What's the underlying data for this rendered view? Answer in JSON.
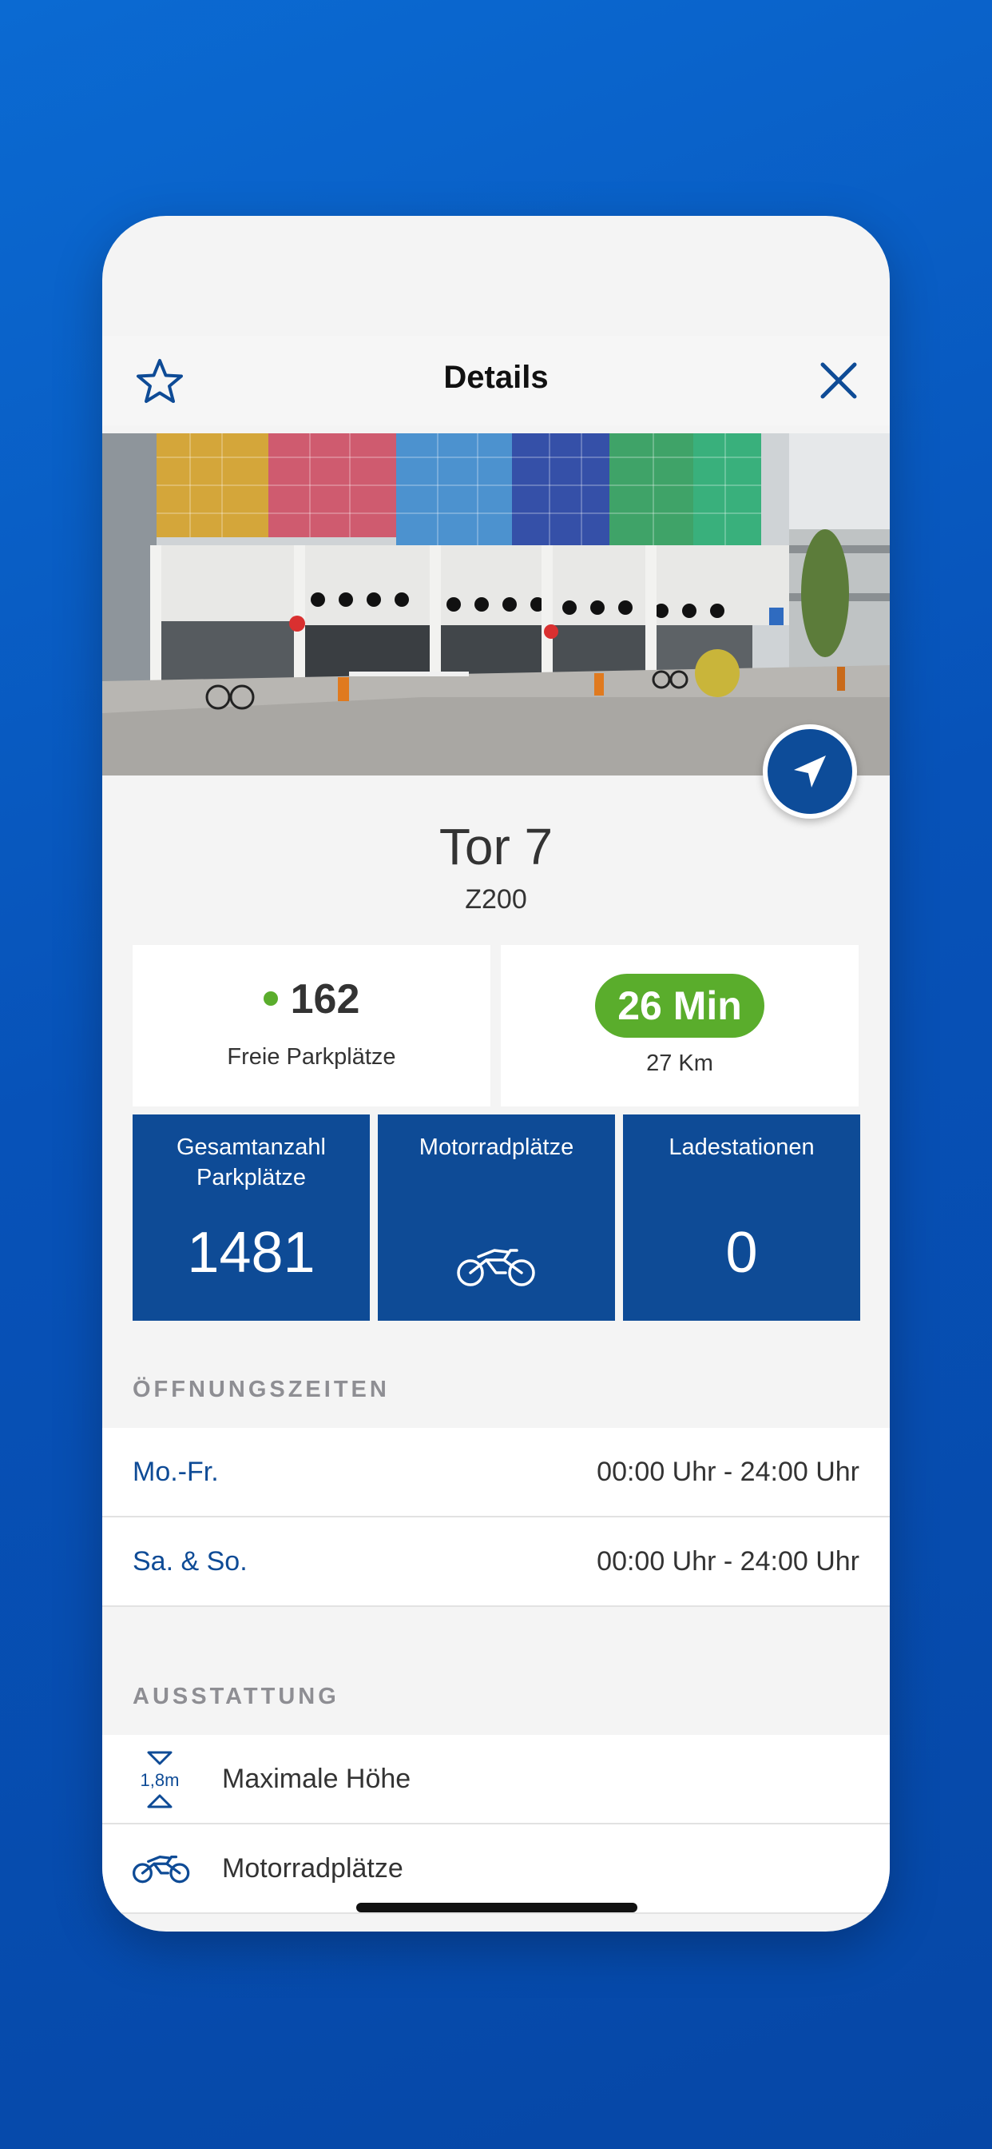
{
  "header": {
    "title": "Details"
  },
  "place": {
    "name": "Tor 7",
    "code": "Z200"
  },
  "availability": {
    "free_count": "162",
    "free_label": "Freie Parkplätze",
    "drive_time": "26 Min",
    "distance": "27 Km"
  },
  "tiles": [
    {
      "label": "Gesamtanzahl Parkplätze",
      "value": "1481"
    },
    {
      "label": "Motorradplätze",
      "icon": "motorcycle-icon"
    },
    {
      "label": "Ladestationen",
      "value": "0"
    }
  ],
  "opening_hours": {
    "heading": "ÖFFNUNGSZEITEN",
    "rows": [
      {
        "days": "Mo.-Fr.",
        "hours": "00:00 Uhr - 24:00 Uhr"
      },
      {
        "days": "Sa. & So.",
        "hours": "00:00 Uhr - 24:00 Uhr"
      }
    ]
  },
  "equipment": {
    "heading": "AUSSTATTUNG",
    "items": [
      {
        "label": "Maximale Höhe",
        "icon": "max-height-icon",
        "icon_text": "1,8m"
      },
      {
        "label": "Motorradplätze",
        "icon": "motorcycle-icon"
      }
    ]
  },
  "colors": {
    "brand_blue": "#0e4b96",
    "accent_green": "#5aad2c",
    "background_gradient": "#0b6ad2"
  }
}
